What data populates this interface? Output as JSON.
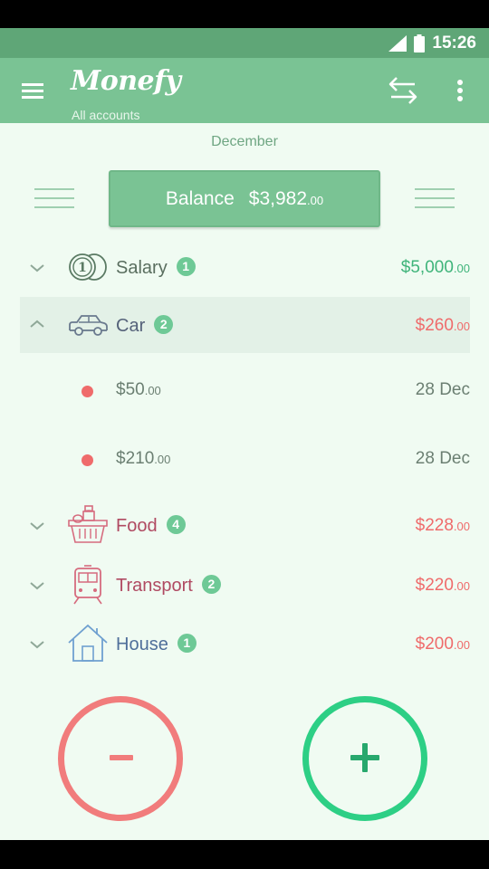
{
  "status": {
    "time": "15:26"
  },
  "app": {
    "title": "Monefy",
    "subtitle": "All accounts"
  },
  "month": "December",
  "balance": {
    "label": "Balance",
    "amount": "$3,982",
    "cents": ".00"
  },
  "categories": [
    {
      "name": "Salary",
      "badge": "1",
      "amount": "$5,000",
      "cents": ".00",
      "type": "income"
    },
    {
      "name": "Car",
      "badge": "2",
      "amount": "$260",
      "cents": ".00",
      "type": "expense",
      "expanded": true,
      "entries": [
        {
          "amount": "$50",
          "cents": ".00",
          "date": "28 Dec"
        },
        {
          "amount": "$210",
          "cents": ".00",
          "date": "28 Dec"
        }
      ]
    },
    {
      "name": "Food",
      "badge": "4",
      "amount": "$228",
      "cents": ".00",
      "type": "expense"
    },
    {
      "name": "Transport",
      "badge": "2",
      "amount": "$220",
      "cents": ".00",
      "type": "expense"
    },
    {
      "name": "House",
      "badge": "1",
      "amount": "$200",
      "cents": ".00",
      "type": "expense"
    }
  ],
  "colors": {
    "primary": "#7ac394",
    "status_bar": "#5fa677",
    "income": "#3fb47a",
    "expense": "#ef6b6b",
    "badge": "#6ec996"
  },
  "icons": {
    "menu": "menu-icon",
    "transfer": "transfer-icon",
    "more": "more-vert-icon",
    "salary": "coins-icon",
    "car": "car-icon",
    "food": "basket-icon",
    "transport": "train-icon",
    "house": "house-icon"
  }
}
